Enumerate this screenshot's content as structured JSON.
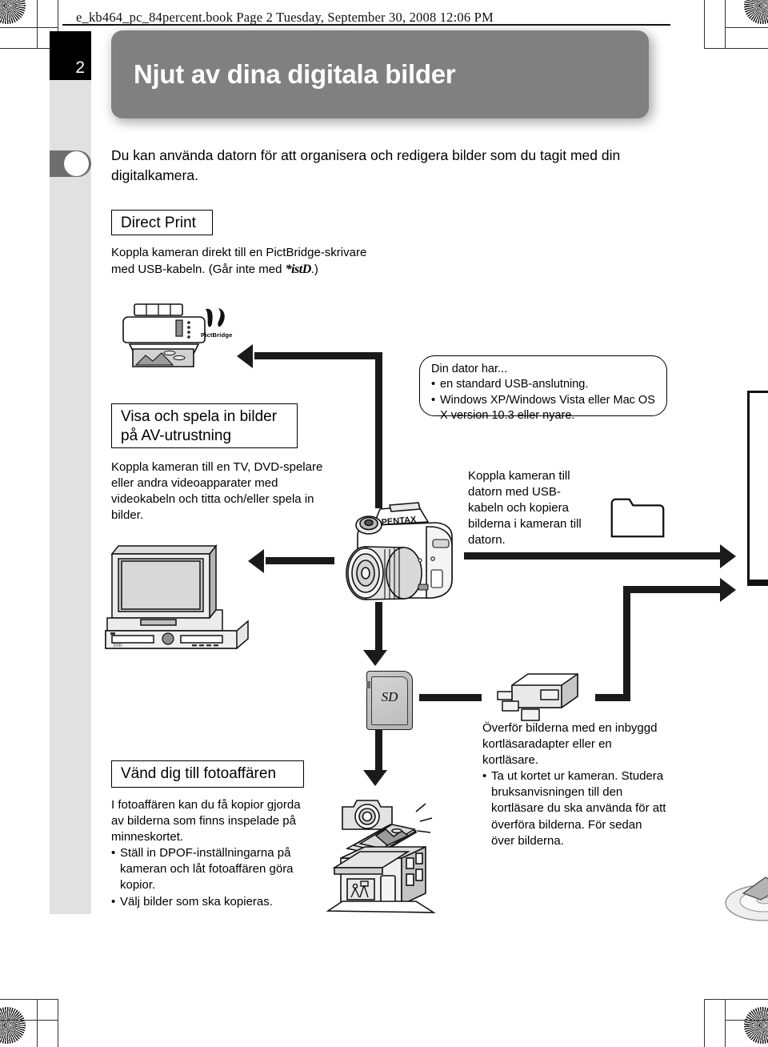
{
  "page": {
    "header_line": "e_kb464_pc_84percent.book  Page 2  Tuesday, September 30, 2008  12:06 PM",
    "chapter_number": "2",
    "chapter_title": "Njut av dina digitala bilder",
    "intro": "Du kan använda datorn för att organisera och redigera bilder som du tagit med din digitalkamera."
  },
  "sections": {
    "direct_print": {
      "heading": "Direct Print",
      "body_line1": "Koppla kameran direkt till en PictBridge-skrivare",
      "body_line2_pre": "med USB-kabeln. (Går inte med ",
      "body_line2_mark": "*istD",
      "body_line2_post": ".)"
    },
    "av": {
      "heading_line1": "Visa och spela in bilder",
      "heading_line2": "på AV-utrustning",
      "body": "Koppla kameran till en TV, DVD-spelare eller andra videoapparater med videokabeln och titta och/eller spela in bilder."
    },
    "photoshop": {
      "heading": "Vänd dig till fotoaffären",
      "body": "I fotoaffären kan du få kopior gjorda av bilderna som finns inspelade på minneskortet.",
      "bullets": [
        "Ställ in DPOF-inställningarna på kameran och låt fotoaffären göra kopior.",
        "Välj bilder som ska kopieras."
      ]
    },
    "usb_transfer": {
      "body": "Koppla kameran till datorn med USB-kabeln och kopiera bilderna i kameran till datorn."
    },
    "card_reader": {
      "body": "Överför bilderna med en inbyggd kortläsaradapter eller en kortläsare.",
      "bullets": [
        "Ta ut kortet ur kameran. Studera bruksanvisningen till den kortläsare du ska använda för att överföra bilderna. För sedan över bilderna."
      ]
    }
  },
  "callout": {
    "title": "Din dator har...",
    "bullets": [
      "en standard USB-anslutning.",
      "Windows XP/Windows Vista eller Mac OS X version 10.3 eller nyare."
    ]
  },
  "labels": {
    "pictbridge": "PictBridge",
    "sd_card": "SD",
    "camera_brand": "PENTAX"
  },
  "colors": {
    "banner_bg": "#808080",
    "tab_black": "#000000",
    "tab_light": "#e1e1e1",
    "tab_dark": "#6e6e6e",
    "arrow": "#1a1a1a",
    "text": "#000000"
  }
}
